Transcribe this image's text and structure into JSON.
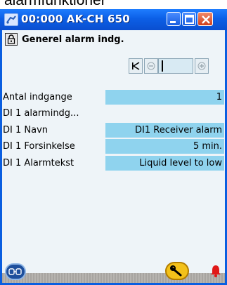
{
  "page": {
    "heading": "alarmfunktioner"
  },
  "window": {
    "title": "00:000 AK-CH 650",
    "app_icon": "controller-icon",
    "buttons": [
      "minimize-icon",
      "maximize-icon",
      "close-icon"
    ]
  },
  "section": {
    "title": "Generel alarm indg.",
    "lock_icon": "lock-icon"
  },
  "navigation": {
    "first_icon": "first-page-icon",
    "prev_icon": "previous-page-icon",
    "next_icon": "next-page-icon"
  },
  "rows": [
    {
      "label": "Antal indgange",
      "value": "1"
    },
    {
      "label": "DI 1 alarmindg...",
      "value": ""
    },
    {
      "label": "DI 1 Navn",
      "value": "DI1 Receiver alarm"
    },
    {
      "label": "DI 1 Forsinkelse",
      "value": "5 min."
    },
    {
      "label": "DI 1 Alarmtekst",
      "value": "Liquid level to low"
    }
  ],
  "statusbar": {
    "left_icon": "service-tool-icon",
    "wrench_icon": "wrench-icon",
    "alarm_icon": "alarm-bell-icon",
    "accent_color": "#f3c11a",
    "alarm_color": "#e01818"
  },
  "colors": {
    "titlebar": "#0c5fe6",
    "value_field": "#8fd3ee",
    "client_background": "#eef4f8"
  }
}
